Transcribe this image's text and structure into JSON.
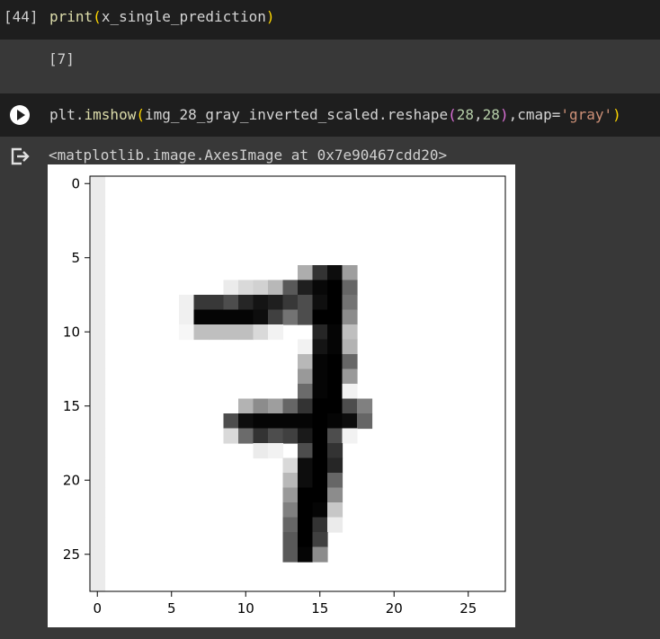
{
  "cell1": {
    "exec_count": "[44]",
    "code": {
      "fn": "print",
      "arg": "x_single_prediction"
    },
    "output": "[7]"
  },
  "cell2": {
    "code": {
      "part1": "plt.",
      "fn": "imshow",
      "arg_obj": "img_28_gray_inverted_scaled.reshape",
      "num1": "28",
      "num2": "28",
      "kw": ",cmap=",
      "str": "'gray'"
    },
    "output_text": "<matplotlib.image.AxesImage at 0x7e90467cdd20>"
  },
  "chart_data": {
    "type": "heatmap",
    "colormap": "gray",
    "grid": false,
    "xlim": [
      -0.5,
      27.5
    ],
    "ylim": [
      27.5,
      -0.5
    ],
    "xticks": [
      0,
      5,
      10,
      15,
      20,
      25
    ],
    "yticks": [
      0,
      5,
      10,
      15,
      20,
      25
    ],
    "pixels": [
      {
        "r": 0,
        "c": 0,
        "v": 0.92
      },
      {
        "r": 1,
        "c": 0,
        "v": 0.92
      },
      {
        "r": 2,
        "c": 0,
        "v": 0.92
      },
      {
        "r": 3,
        "c": 0,
        "v": 0.92
      },
      {
        "r": 4,
        "c": 0,
        "v": 0.92
      },
      {
        "r": 5,
        "c": 0,
        "v": 0.92
      },
      {
        "r": 6,
        "c": 0,
        "v": 0.92
      },
      {
        "r": 7,
        "c": 0,
        "v": 0.92
      },
      {
        "r": 8,
        "c": 0,
        "v": 0.92
      },
      {
        "r": 9,
        "c": 0,
        "v": 0.92
      },
      {
        "r": 10,
        "c": 0,
        "v": 0.92
      },
      {
        "r": 11,
        "c": 0,
        "v": 0.92
      },
      {
        "r": 12,
        "c": 0,
        "v": 0.92
      },
      {
        "r": 13,
        "c": 0,
        "v": 0.92
      },
      {
        "r": 14,
        "c": 0,
        "v": 0.92
      },
      {
        "r": 15,
        "c": 0,
        "v": 0.92
      },
      {
        "r": 16,
        "c": 0,
        "v": 0.92
      },
      {
        "r": 17,
        "c": 0,
        "v": 0.92
      },
      {
        "r": 18,
        "c": 0,
        "v": 0.92
      },
      {
        "r": 19,
        "c": 0,
        "v": 0.92
      },
      {
        "r": 20,
        "c": 0,
        "v": 0.92
      },
      {
        "r": 21,
        "c": 0,
        "v": 0.92
      },
      {
        "r": 22,
        "c": 0,
        "v": 0.92
      },
      {
        "r": 23,
        "c": 0,
        "v": 0.92
      },
      {
        "r": 24,
        "c": 0,
        "v": 0.92
      },
      {
        "r": 25,
        "c": 0,
        "v": 0.92
      },
      {
        "r": 26,
        "c": 0,
        "v": 0.92
      },
      {
        "r": 27,
        "c": 0,
        "v": 0.92
      },
      {
        "r": 6,
        "c": 14,
        "v": 0.68
      },
      {
        "r": 6,
        "c": 15,
        "v": 0.2
      },
      {
        "r": 6,
        "c": 16,
        "v": 0.05
      },
      {
        "r": 6,
        "c": 17,
        "v": 0.62
      },
      {
        "r": 7,
        "c": 9,
        "v": 0.92
      },
      {
        "r": 7,
        "c": 10,
        "v": 0.85
      },
      {
        "r": 7,
        "c": 11,
        "v": 0.82
      },
      {
        "r": 7,
        "c": 12,
        "v": 0.72
      },
      {
        "r": 7,
        "c": 13,
        "v": 0.35
      },
      {
        "r": 7,
        "c": 14,
        "v": 0.12
      },
      {
        "r": 7,
        "c": 15,
        "v": 0.03
      },
      {
        "r": 7,
        "c": 16,
        "v": 0.0
      },
      {
        "r": 7,
        "c": 17,
        "v": 0.4
      },
      {
        "r": 8,
        "c": 6,
        "v": 0.94
      },
      {
        "r": 8,
        "c": 7,
        "v": 0.22
      },
      {
        "r": 8,
        "c": 8,
        "v": 0.22
      },
      {
        "r": 8,
        "c": 9,
        "v": 0.3
      },
      {
        "r": 8,
        "c": 10,
        "v": 0.15
      },
      {
        "r": 8,
        "c": 11,
        "v": 0.08
      },
      {
        "r": 8,
        "c": 12,
        "v": 0.12
      },
      {
        "r": 8,
        "c": 13,
        "v": 0.22
      },
      {
        "r": 8,
        "c": 14,
        "v": 0.3
      },
      {
        "r": 8,
        "c": 15,
        "v": 0.06
      },
      {
        "r": 8,
        "c": 16,
        "v": 0.0
      },
      {
        "r": 8,
        "c": 17,
        "v": 0.45
      },
      {
        "r": 9,
        "c": 6,
        "v": 0.94
      },
      {
        "r": 9,
        "c": 7,
        "v": 0.02
      },
      {
        "r": 9,
        "c": 8,
        "v": 0.02
      },
      {
        "r": 9,
        "c": 9,
        "v": 0.02
      },
      {
        "r": 9,
        "c": 10,
        "v": 0.02
      },
      {
        "r": 9,
        "c": 11,
        "v": 0.05
      },
      {
        "r": 9,
        "c": 12,
        "v": 0.25
      },
      {
        "r": 9,
        "c": 13,
        "v": 0.45
      },
      {
        "r": 9,
        "c": 14,
        "v": 0.3
      },
      {
        "r": 9,
        "c": 15,
        "v": 0.0
      },
      {
        "r": 9,
        "c": 16,
        "v": 0.0
      },
      {
        "r": 9,
        "c": 17,
        "v": 0.55
      },
      {
        "r": 10,
        "c": 6,
        "v": 0.97
      },
      {
        "r": 10,
        "c": 7,
        "v": 0.75
      },
      {
        "r": 10,
        "c": 8,
        "v": 0.75
      },
      {
        "r": 10,
        "c": 9,
        "v": 0.75
      },
      {
        "r": 10,
        "c": 10,
        "v": 0.75
      },
      {
        "r": 10,
        "c": 11,
        "v": 0.85
      },
      {
        "r": 10,
        "c": 12,
        "v": 0.95
      },
      {
        "r": 10,
        "c": 15,
        "v": 0.15
      },
      {
        "r": 10,
        "c": 16,
        "v": 0.02
      },
      {
        "r": 10,
        "c": 17,
        "v": 0.75
      },
      {
        "r": 11,
        "c": 14,
        "v": 0.95
      },
      {
        "r": 11,
        "c": 15,
        "v": 0.08
      },
      {
        "r": 11,
        "c": 16,
        "v": 0.02
      },
      {
        "r": 11,
        "c": 17,
        "v": 0.7
      },
      {
        "r": 12,
        "c": 14,
        "v": 0.72
      },
      {
        "r": 12,
        "c": 15,
        "v": 0.02
      },
      {
        "r": 12,
        "c": 16,
        "v": 0.0
      },
      {
        "r": 12,
        "c": 17,
        "v": 0.4
      },
      {
        "r": 13,
        "c": 14,
        "v": 0.6
      },
      {
        "r": 13,
        "c": 15,
        "v": 0.02
      },
      {
        "r": 13,
        "c": 16,
        "v": 0.0
      },
      {
        "r": 13,
        "c": 17,
        "v": 0.6
      },
      {
        "r": 14,
        "c": 14,
        "v": 0.42
      },
      {
        "r": 14,
        "c": 15,
        "v": 0.02
      },
      {
        "r": 14,
        "c": 16,
        "v": 0.0
      },
      {
        "r": 14,
        "c": 17,
        "v": 0.95
      },
      {
        "r": 15,
        "c": 10,
        "v": 0.7
      },
      {
        "r": 15,
        "c": 11,
        "v": 0.55
      },
      {
        "r": 15,
        "c": 12,
        "v": 0.62
      },
      {
        "r": 15,
        "c": 13,
        "v": 0.4
      },
      {
        "r": 15,
        "c": 14,
        "v": 0.2
      },
      {
        "r": 15,
        "c": 15,
        "v": 0.0
      },
      {
        "r": 15,
        "c": 16,
        "v": 0.0
      },
      {
        "r": 15,
        "c": 17,
        "v": 0.3
      },
      {
        "r": 15,
        "c": 18,
        "v": 0.5
      },
      {
        "r": 16,
        "c": 9,
        "v": 0.3
      },
      {
        "r": 16,
        "c": 10,
        "v": 0.05
      },
      {
        "r": 16,
        "c": 11,
        "v": 0.02
      },
      {
        "r": 16,
        "c": 12,
        "v": 0.02
      },
      {
        "r": 16,
        "c": 13,
        "v": 0.02
      },
      {
        "r": 16,
        "c": 14,
        "v": 0.02
      },
      {
        "r": 16,
        "c": 15,
        "v": 0.0
      },
      {
        "r": 16,
        "c": 16,
        "v": 0.02
      },
      {
        "r": 16,
        "c": 17,
        "v": 0.05
      },
      {
        "r": 16,
        "c": 18,
        "v": 0.4
      },
      {
        "r": 17,
        "c": 9,
        "v": 0.85
      },
      {
        "r": 17,
        "c": 10,
        "v": 0.42
      },
      {
        "r": 17,
        "c": 11,
        "v": 0.2
      },
      {
        "r": 17,
        "c": 12,
        "v": 0.3
      },
      {
        "r": 17,
        "c": 13,
        "v": 0.25
      },
      {
        "r": 17,
        "c": 14,
        "v": 0.1
      },
      {
        "r": 17,
        "c": 15,
        "v": 0.0
      },
      {
        "r": 17,
        "c": 16,
        "v": 0.3
      },
      {
        "r": 17,
        "c": 17,
        "v": 0.95
      },
      {
        "r": 18,
        "c": 11,
        "v": 0.92
      },
      {
        "r": 18,
        "c": 12,
        "v": 0.95
      },
      {
        "r": 18,
        "c": 14,
        "v": 0.3
      },
      {
        "r": 18,
        "c": 15,
        "v": 0.0
      },
      {
        "r": 18,
        "c": 16,
        "v": 0.2
      },
      {
        "r": 19,
        "c": 13,
        "v": 0.85
      },
      {
        "r": 19,
        "c": 14,
        "v": 0.05
      },
      {
        "r": 19,
        "c": 15,
        "v": 0.0
      },
      {
        "r": 19,
        "c": 16,
        "v": 0.15
      },
      {
        "r": 20,
        "c": 13,
        "v": 0.72
      },
      {
        "r": 20,
        "c": 14,
        "v": 0.05
      },
      {
        "r": 20,
        "c": 15,
        "v": 0.0
      },
      {
        "r": 20,
        "c": 16,
        "v": 0.4
      },
      {
        "r": 21,
        "c": 13,
        "v": 0.6
      },
      {
        "r": 21,
        "c": 14,
        "v": 0.0
      },
      {
        "r": 21,
        "c": 15,
        "v": 0.0
      },
      {
        "r": 21,
        "c": 16,
        "v": 0.55
      },
      {
        "r": 22,
        "c": 13,
        "v": 0.5
      },
      {
        "r": 22,
        "c": 14,
        "v": 0.0
      },
      {
        "r": 22,
        "c": 15,
        "v": 0.02
      },
      {
        "r": 22,
        "c": 16,
        "v": 0.78
      },
      {
        "r": 23,
        "c": 13,
        "v": 0.4
      },
      {
        "r": 23,
        "c": 14,
        "v": 0.0
      },
      {
        "r": 23,
        "c": 15,
        "v": 0.2
      },
      {
        "r": 23,
        "c": 16,
        "v": 0.92
      },
      {
        "r": 24,
        "c": 13,
        "v": 0.35
      },
      {
        "r": 24,
        "c": 14,
        "v": 0.0
      },
      {
        "r": 24,
        "c": 15,
        "v": 0.25
      },
      {
        "r": 25,
        "c": 13,
        "v": 0.35
      },
      {
        "r": 25,
        "c": 14,
        "v": 0.02
      },
      {
        "r": 25,
        "c": 15,
        "v": 0.55
      }
    ]
  },
  "icons": {
    "run": "play-circle-icon",
    "output": "output-arrow-icon"
  },
  "colors": {
    "cell_bg": "#1e1e1e",
    "output_bg": "#383838",
    "function": "#dcdcaa",
    "paren": "#ffd700",
    "string": "#ce9178",
    "number": "#b5cea8"
  }
}
